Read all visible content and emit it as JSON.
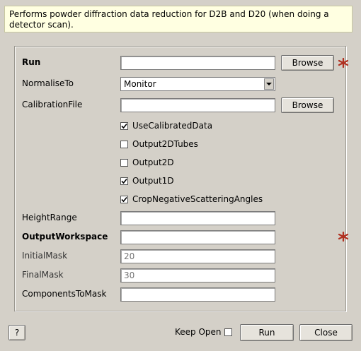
{
  "description": "Performs powder diffraction data reduction for D2B and D20 (when doing a detector scan).",
  "fields": {
    "run": {
      "label": "Run",
      "value": "",
      "browse_label": "Browse"
    },
    "normalise_to": {
      "label": "NormaliseTo",
      "selected": "Monitor"
    },
    "calibration_file": {
      "label": "CalibrationFile",
      "value": "",
      "browse_label": "Browse"
    },
    "height_range": {
      "label": "HeightRange",
      "value": ""
    },
    "output_workspace": {
      "label": "OutputWorkspace",
      "value": ""
    },
    "initial_mask": {
      "label": "InitialMask",
      "value": "",
      "placeholder": "20"
    },
    "final_mask": {
      "label": "FinalMask",
      "value": "",
      "placeholder": "30"
    },
    "components_to_mask": {
      "label": "ComponentsToMask",
      "value": ""
    }
  },
  "checkboxes": [
    {
      "label": "UseCalibratedData",
      "checked": true
    },
    {
      "label": "Output2DTubes",
      "checked": false
    },
    {
      "label": "Output2D",
      "checked": false
    },
    {
      "label": "Output1D",
      "checked": true
    },
    {
      "label": "CropNegativeScatteringAngles",
      "checked": true
    }
  ],
  "footer": {
    "help_label": "?",
    "keep_open_label": "Keep Open",
    "keep_open_checked": false,
    "run_label": "Run",
    "close_label": "Close"
  },
  "colors": {
    "required_marker": "#b03020",
    "tooltip_bg": "#ffffe1"
  },
  "icons": {
    "required": "asterisk-icon",
    "dropdown": "chevron-down-icon",
    "check": "check-icon"
  }
}
